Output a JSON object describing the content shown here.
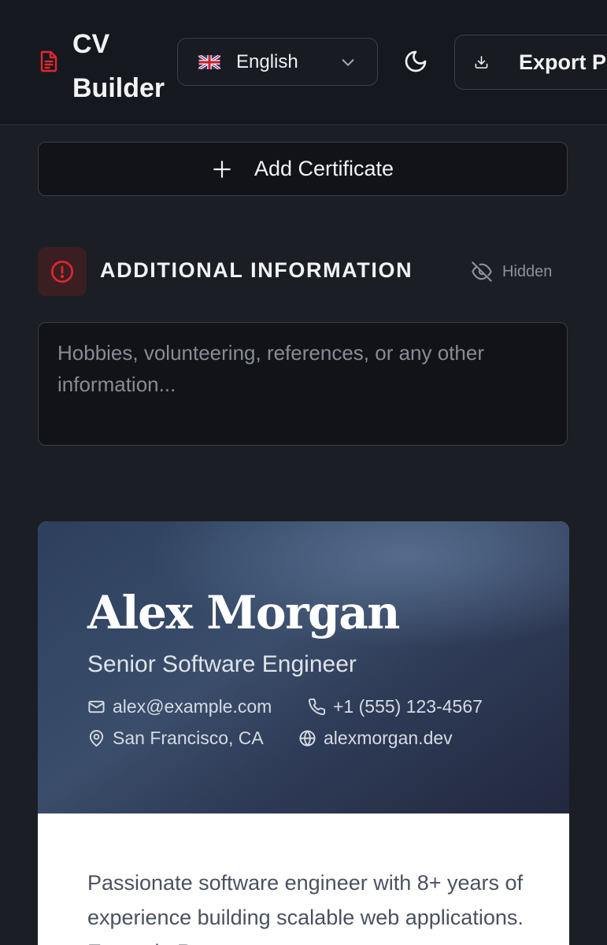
{
  "header": {
    "app_title": "CV Builder",
    "language": "English",
    "export_label": "Export PDF"
  },
  "certificates": {
    "add_label": "Add Certificate"
  },
  "additional_info": {
    "title": "ADDITIONAL INFORMATION",
    "visibility_label": "Hidden",
    "placeholder": "Hobbies, volunteering, references, or any other information...",
    "value": ""
  },
  "cv_preview": {
    "name": "Alex Morgan",
    "role": "Senior Software Engineer",
    "email": "alex@example.com",
    "phone": "+1 (555) 123-4567",
    "location": "San Francisco, CA",
    "website": "alexmorgan.dev",
    "summary": "Passionate software engineer with 8+ years of experience building scalable web applications. Expert in React"
  },
  "colors": {
    "accent": "#e0282e",
    "background": "#1b1e25",
    "header_bg": "#15181e",
    "hero_start": "#2d3f5c",
    "hero_end": "#22283e"
  },
  "icons": {
    "brand": "document-icon",
    "flag": "uk-flag-icon",
    "theme": "moon-icon",
    "export": "download-icon",
    "add": "plus-icon",
    "section": "info-circle-icon",
    "visibility": "eye-off-icon"
  }
}
